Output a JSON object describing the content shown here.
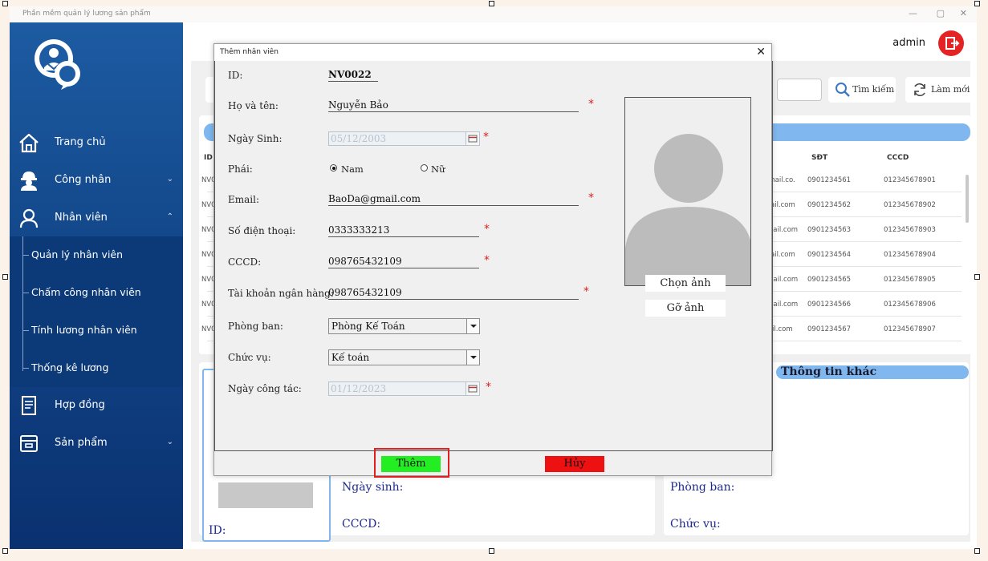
{
  "app": {
    "title": "Phần mềm quản lý lương sản phẩm",
    "user": "admin"
  },
  "sidebar": {
    "items": [
      {
        "label": "Trang chủ",
        "icon": "home-icon"
      },
      {
        "label": "Công nhân",
        "icon": "worker-icon"
      },
      {
        "label": "Nhân viên",
        "icon": "user-icon"
      },
      {
        "label": "Hợp đồng",
        "icon": "contract-icon"
      },
      {
        "label": "Sản phẩm",
        "icon": "product-box-icon"
      }
    ],
    "submenu": [
      {
        "label": "Quản lý nhân viên"
      },
      {
        "label": "Chấm công nhân viên"
      },
      {
        "label": "Tính lương nhân viên"
      },
      {
        "label": "Thống kê lương"
      }
    ]
  },
  "toolbar": {
    "search_label": "Tìm kiếm",
    "refresh_label": "Làm mới"
  },
  "table": {
    "headers": {
      "id": "ID",
      "phone": "SĐT",
      "cccd": "CCCD"
    },
    "rows": [
      {
        "id": "NV0",
        "email": "gmail.co.",
        "phone": "0901234561",
        "cccd": "012345678901"
      },
      {
        "id": "NV0",
        "email": "ail.com",
        "phone": "0901234562",
        "cccd": "012345678902"
      },
      {
        "id": "NV0",
        "email": "mail.com",
        "phone": "0901234563",
        "cccd": "012345678903"
      },
      {
        "id": "NV0",
        "email": "ail.com",
        "phone": "0901234564",
        "cccd": "012345678904"
      },
      {
        "id": "NV0",
        "email": "nail.com",
        "phone": "0901234565",
        "cccd": "012345678905"
      },
      {
        "id": "NV0",
        "email": "nail.com",
        "phone": "0901234566",
        "cccd": "012345678906"
      },
      {
        "id": "NV0",
        "email": "il.com",
        "phone": "0901234567",
        "cccd": "012345678907"
      }
    ]
  },
  "details": {
    "id_label": "ID:",
    "birth_label": "Ngày sinh:",
    "cccd_label": "CCCD:",
    "department_label": "Phòng ban:",
    "position_label": "Chức vụ:",
    "other_info_title": "Thông tin khác"
  },
  "dialog": {
    "title": "Thêm nhân viên",
    "fields": {
      "id": {
        "label": "ID:",
        "value": "NV0022"
      },
      "name": {
        "label": "Họ và tên:",
        "value": "Nguyễn Bảo"
      },
      "birth": {
        "label": "Ngày Sinh:",
        "value": "05/12/2003"
      },
      "gender": {
        "label": "Phái:",
        "male": "Nam",
        "female": "Nữ",
        "selected": "Nam"
      },
      "email": {
        "label": "Email:",
        "value": "BaoDa@gmail.com"
      },
      "phone": {
        "label": "Số điện thoại:",
        "value": "0333333213"
      },
      "cccd": {
        "label": "CCCD:",
        "value": "098765432109"
      },
      "bank": {
        "label": "Tài khoản ngân hàng:",
        "value": "098765432109"
      },
      "department": {
        "label": "Phòng ban:",
        "value": "Phòng Kế Toán"
      },
      "position": {
        "label": "Chức vụ:",
        "value": "Kế toán"
      },
      "start_date": {
        "label": "Ngày công tác:",
        "value": "01/12/2023"
      }
    },
    "required_mark": "*",
    "choose_photo": "Chọn ảnh",
    "remove_photo": "Gỡ ảnh",
    "add_button": "Thêm",
    "cancel_button": "Hủy"
  },
  "colors": {
    "sidebar_top": "#1d5ba2",
    "sidebar_bottom": "#0a3170",
    "accent_band": "#7fb7ee",
    "add_green": "#22ee22",
    "cancel_red": "#ee1111",
    "logout_red": "#e42424"
  }
}
